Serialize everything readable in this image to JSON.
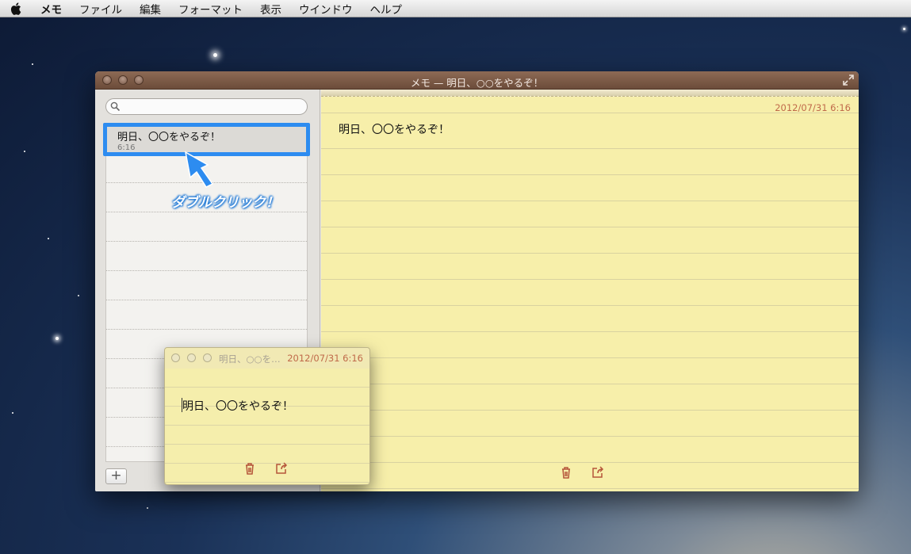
{
  "menubar": {
    "items": [
      "メモ",
      "ファイル",
      "編集",
      "フォーマット",
      "表示",
      "ウインドウ",
      "ヘルプ"
    ]
  },
  "window": {
    "title": "メモ — 明日、○○をやるぞ！"
  },
  "sidebar": {
    "search_placeholder": "",
    "notes": [
      {
        "title": "明日、〇〇をやるぞ！",
        "time": "6:16"
      }
    ],
    "add_label": "+"
  },
  "note": {
    "date": "2012/07/31 6:16",
    "body": "明日、〇〇をやるぞ！"
  },
  "callout": {
    "text": "ダブルクリック！",
    "color": "#2d8cf0"
  },
  "float_note": {
    "title": "明日、○○を…",
    "date": "2012/07/31 6:16",
    "body": "明日、〇〇をやるぞ！"
  },
  "icons": {
    "trash": "trash-icon",
    "share": "share-icon"
  },
  "colors": {
    "paper": "#f7efaa",
    "accent_date": "#c06a4a",
    "titlebar": "#7a5a46"
  }
}
